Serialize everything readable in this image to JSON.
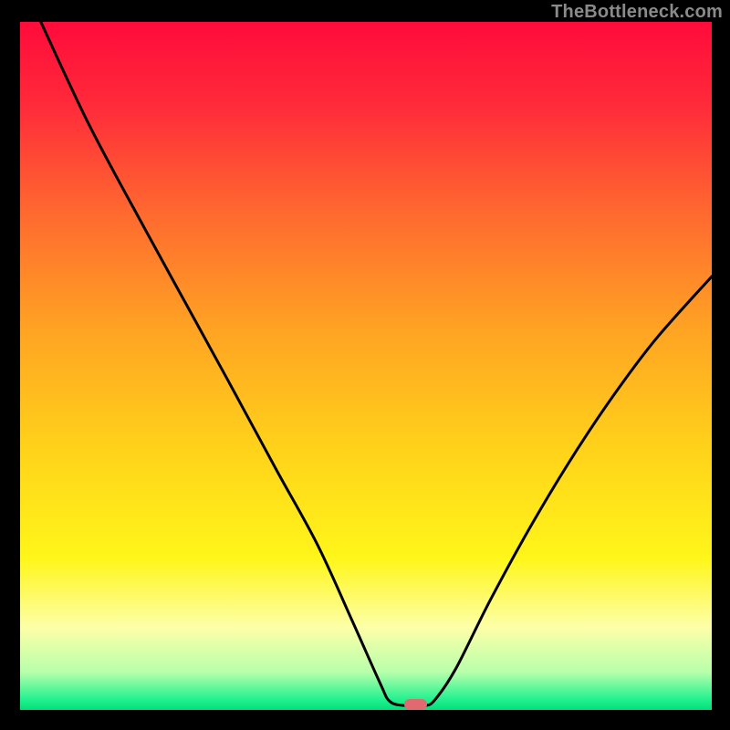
{
  "watermark": "TheBottleneck.com",
  "chart_data": {
    "type": "line",
    "title": "",
    "xlabel": "",
    "ylabel": "",
    "xlim": [
      0,
      100
    ],
    "ylim": [
      0,
      100
    ],
    "grid": false,
    "legend": false,
    "gradient_stops": [
      {
        "pos": 0.0,
        "color": "#ff0b3b"
      },
      {
        "pos": 0.12,
        "color": "#ff2a3a"
      },
      {
        "pos": 0.28,
        "color": "#ff6a2f"
      },
      {
        "pos": 0.45,
        "color": "#ffa423"
      },
      {
        "pos": 0.62,
        "color": "#ffd21a"
      },
      {
        "pos": 0.78,
        "color": "#fff61a"
      },
      {
        "pos": 0.88,
        "color": "#fdffa8"
      },
      {
        "pos": 0.945,
        "color": "#b8ffab"
      },
      {
        "pos": 0.985,
        "color": "#22f18f"
      },
      {
        "pos": 1.0,
        "color": "#00e07a"
      }
    ],
    "series": [
      {
        "name": "bottleneck-curve",
        "color": "#000000",
        "points": [
          {
            "x": 3.0,
            "y": 100.0
          },
          {
            "x": 10.0,
            "y": 85.0
          },
          {
            "x": 18.0,
            "y": 70.0
          },
          {
            "x": 24.0,
            "y": 59.0
          },
          {
            "x": 30.0,
            "y": 48.0
          },
          {
            "x": 37.0,
            "y": 35.0
          },
          {
            "x": 43.0,
            "y": 24.0
          },
          {
            "x": 48.0,
            "y": 13.0
          },
          {
            "x": 52.0,
            "y": 4.0
          },
          {
            "x": 53.5,
            "y": 1.2
          },
          {
            "x": 56.0,
            "y": 0.6
          },
          {
            "x": 58.5,
            "y": 0.6
          },
          {
            "x": 60.0,
            "y": 1.5
          },
          {
            "x": 63.0,
            "y": 6.0
          },
          {
            "x": 68.0,
            "y": 16.0
          },
          {
            "x": 74.0,
            "y": 27.0
          },
          {
            "x": 80.0,
            "y": 37.0
          },
          {
            "x": 86.0,
            "y": 46.0
          },
          {
            "x": 92.0,
            "y": 54.0
          },
          {
            "x": 100.0,
            "y": 63.0
          }
        ]
      }
    ],
    "marker": {
      "name": "optimal-point",
      "x": 57.2,
      "y": 0.8,
      "w_pct": 3.3,
      "h_pct": 1.7,
      "color": "#e06a6f"
    }
  }
}
